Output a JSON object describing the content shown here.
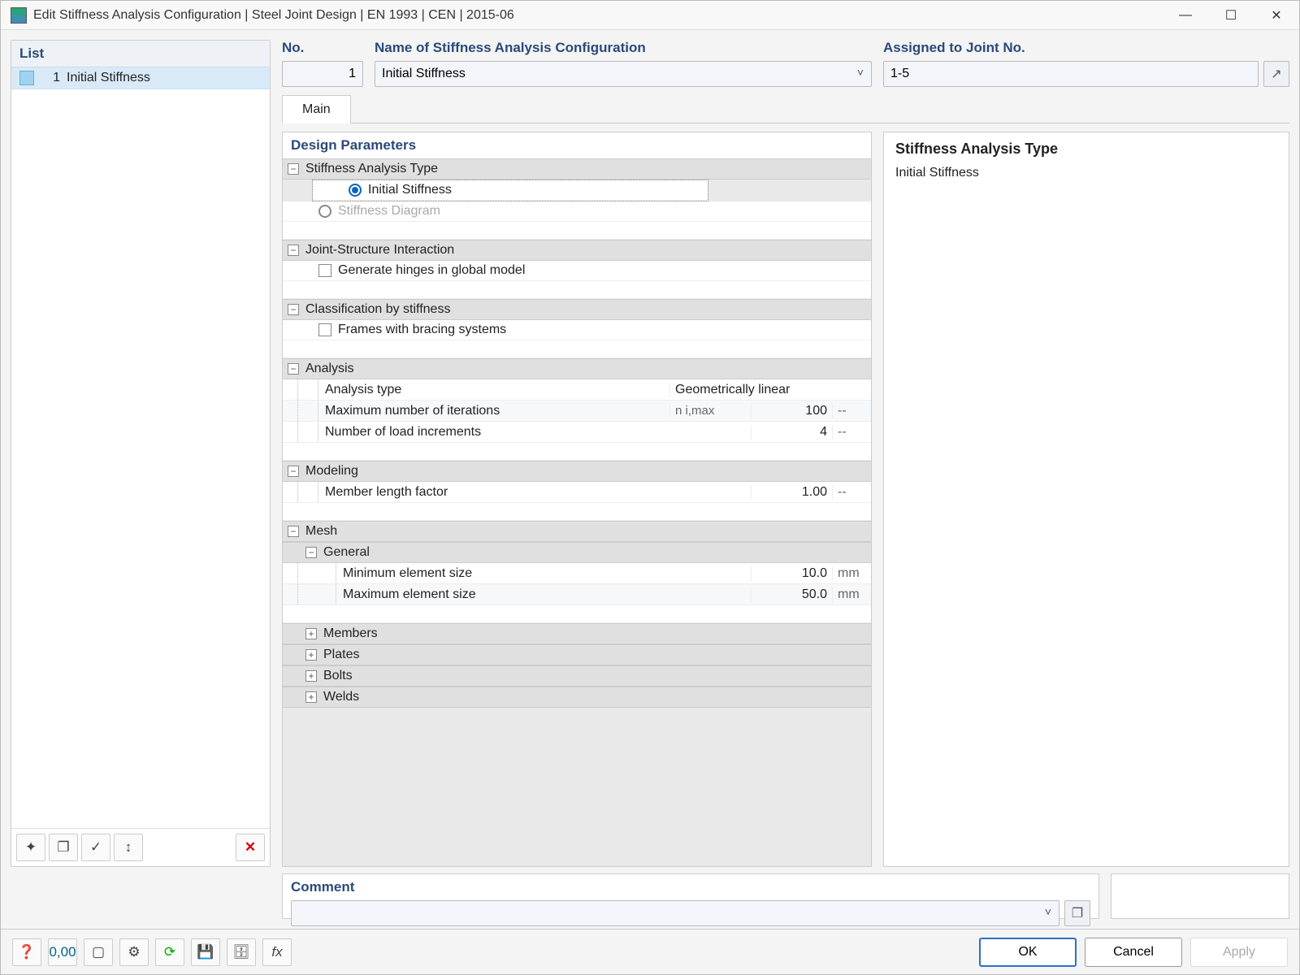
{
  "window": {
    "title": "Edit Stiffness Analysis Configuration | Steel Joint Design | EN 1993 | CEN | 2015-06"
  },
  "list": {
    "header": "List",
    "items": [
      {
        "num": "1",
        "label": "Initial Stiffness"
      }
    ]
  },
  "fields": {
    "no_label": "No.",
    "no_value": "1",
    "name_label": "Name of Stiffness Analysis Configuration",
    "name_value": "Initial Stiffness",
    "assigned_label": "Assigned to Joint No.",
    "assigned_value": "1-5"
  },
  "tabs": {
    "main": "Main"
  },
  "params": {
    "header": "Design Parameters",
    "s_type": {
      "title": "Stiffness Analysis Type",
      "opt_initial": "Initial Stiffness",
      "opt_diagram": "Stiffness Diagram"
    },
    "interaction": {
      "title": "Joint-Structure Interaction",
      "opt_hinges": "Generate hinges in global model"
    },
    "classification": {
      "title": "Classification by stiffness",
      "opt_bracing": "Frames with bracing systems"
    },
    "analysis": {
      "title": "Analysis",
      "type_label": "Analysis type",
      "type_value": "Geometrically linear",
      "iter_label": "Maximum number of iterations",
      "iter_sym": "n i,max",
      "iter_val": "100",
      "iter_unit": "--",
      "incr_label": "Number of load increments",
      "incr_val": "4",
      "incr_unit": "--"
    },
    "modeling": {
      "title": "Modeling",
      "mlf_label": "Member length factor",
      "mlf_val": "1.00",
      "mlf_unit": "--"
    },
    "mesh": {
      "title": "Mesh",
      "general": "General",
      "min_label": "Minimum element size",
      "min_val": "10.0",
      "min_unit": "mm",
      "max_label": "Maximum element size",
      "max_val": "50.0",
      "max_unit": "mm",
      "members": "Members",
      "plates": "Plates",
      "bolts": "Bolts",
      "welds": "Welds"
    }
  },
  "info": {
    "title": "Stiffness Analysis Type",
    "text": "Initial Stiffness"
  },
  "comment": {
    "label": "Comment",
    "value": ""
  },
  "buttons": {
    "ok": "OK",
    "cancel": "Cancel",
    "apply": "Apply"
  }
}
